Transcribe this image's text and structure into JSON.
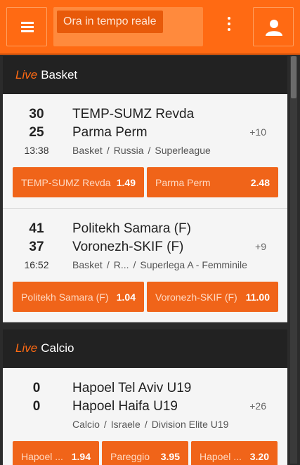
{
  "header": {
    "search_chip": "Ora in tempo reale"
  },
  "sections": [
    {
      "live_label": "Live",
      "sport_label": "Basket",
      "events": [
        {
          "score_home": "30",
          "score_away": "25",
          "time": "13:38",
          "home": "TEMP-SUMZ Revda",
          "away": "Parma Perm",
          "sport": "Basket",
          "country": "Russia",
          "league": "Superleague",
          "more": "+10",
          "odds": [
            {
              "label": "TEMP-SUMZ Revda",
              "value": "1.49"
            },
            {
              "label": "Parma Perm",
              "value": "2.48"
            }
          ]
        },
        {
          "score_home": "41",
          "score_away": "37",
          "time": "16:52",
          "home": "Politekh Samara (F)",
          "away": "Voronezh-SKIF (F)",
          "sport": "Basket",
          "country": "R...",
          "league": "Superlega A - Femminile",
          "more": "+9",
          "odds": [
            {
              "label": "Politekh Samara (F)",
              "value": "1.04"
            },
            {
              "label": "Voronezh-SKIF (F)",
              "value": "11.00"
            }
          ]
        }
      ]
    },
    {
      "live_label": "Live",
      "sport_label": "Calcio",
      "events": [
        {
          "score_home": "0",
          "score_away": "0",
          "time": "",
          "home": "Hapoel Tel Aviv U19",
          "away": "Hapoel Haifa U19",
          "sport": "Calcio",
          "country": "Israele",
          "league": "Division Elite U19",
          "more": "+26",
          "odds": [
            {
              "label": "Hapoel ...",
              "value": "1.94"
            },
            {
              "label": "Pareggio",
              "value": "3.95"
            },
            {
              "label": "Hapoel ...",
              "value": "3.20"
            }
          ]
        }
      ]
    }
  ]
}
